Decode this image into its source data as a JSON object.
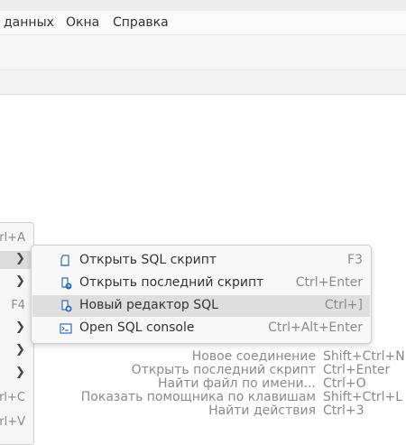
{
  "menubar": {
    "items": [
      {
        "label": "данных"
      },
      {
        "label": "Окна"
      },
      {
        "label": "Справка"
      }
    ]
  },
  "left_menu": {
    "rows": [
      {
        "text": "rl+A",
        "chevron": false
      },
      {
        "text": "",
        "chevron": true
      },
      {
        "text": "",
        "chevron": true
      },
      {
        "text": "F4",
        "chevron": false
      },
      {
        "text": "",
        "chevron": true
      },
      {
        "text": "",
        "chevron": true
      },
      {
        "text": "",
        "chevron": true
      },
      {
        "text": "rl+C",
        "chevron": false
      },
      {
        "text": "rl+V",
        "chevron": false
      }
    ]
  },
  "submenu": {
    "items": [
      {
        "label": "Открыть SQL скрипт",
        "shortcut": "F3",
        "icon": "sql-script-icon"
      },
      {
        "label": "Открыть последний скрипт",
        "shortcut": "Ctrl+Enter",
        "icon": "recent-script-icon"
      },
      {
        "label": "Новый редактор SQL",
        "shortcut": "Ctrl+]",
        "icon": "new-sql-editor-icon",
        "highlighted": true
      },
      {
        "label": "Open SQL console",
        "shortcut": "Ctrl+Alt+Enter",
        "icon": "sql-console-icon"
      }
    ]
  },
  "hints": [
    {
      "label": "Новое соединение",
      "key": "Shift+Ctrl+N"
    },
    {
      "label": "Открыть последний скрипт",
      "key": "Ctrl+Enter"
    },
    {
      "label": "Найти файл по имени...",
      "key": "Ctrl+O"
    },
    {
      "label": "Показать помощника по клавишам",
      "key": "Shift+Ctrl+L"
    },
    {
      "label": "Найти действия",
      "key": "Ctrl+3"
    }
  ],
  "colors": {
    "accent": "#2f6db5",
    "highlight": "#dedede",
    "muted_text": "#8a8a8a"
  }
}
